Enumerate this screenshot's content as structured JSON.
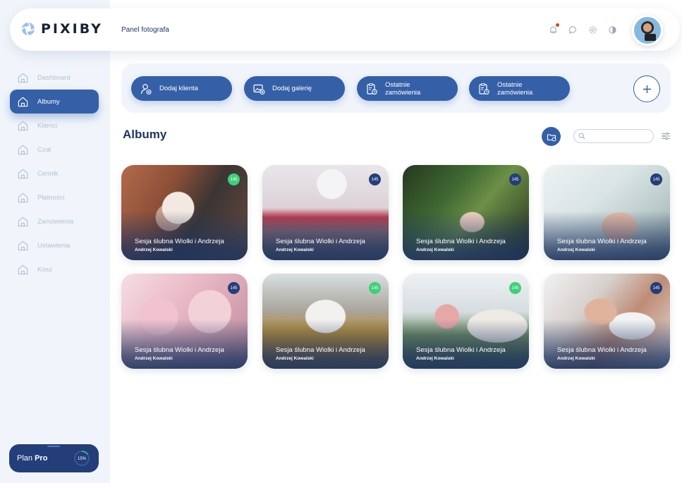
{
  "app": {
    "logo_text": "PIXIBY",
    "subtitle": "Panel fotografa"
  },
  "header_icons": [
    "bell-icon",
    "chat-icon",
    "gear-icon",
    "contrast-icon"
  ],
  "sidebar": {
    "items": [
      {
        "label": "Dashboard",
        "icon": "home-icon",
        "active": false
      },
      {
        "label": "Albumy",
        "icon": "home-icon",
        "active": true
      },
      {
        "label": "Klienci",
        "icon": "home-icon",
        "active": false
      },
      {
        "label": "Czat",
        "icon": "home-icon",
        "active": false
      },
      {
        "label": "Cennik",
        "icon": "home-icon",
        "active": false
      },
      {
        "label": "Płatności",
        "icon": "home-icon",
        "active": false
      },
      {
        "label": "Zamówienia",
        "icon": "home-icon",
        "active": false
      },
      {
        "label": "Ustawienia",
        "icon": "home-icon",
        "active": false
      },
      {
        "label": "Kosz",
        "icon": "home-icon",
        "active": false
      }
    ],
    "plan": {
      "prefix": "Plan",
      "name": "Pro",
      "progress_label": "15%",
      "progress": 0.15
    }
  },
  "actions": [
    {
      "label": "Dodaj klienta",
      "icon": "add-user-icon"
    },
    {
      "label": "Dodaj galerię",
      "icon": "add-gallery-icon"
    },
    {
      "label": "Ostatnie zamówienia",
      "icon": "clipboard-clock-icon"
    },
    {
      "label": "Ostatnie zamówienia",
      "icon": "clipboard-clock-icon"
    }
  ],
  "main": {
    "title": "Albumy",
    "search_placeholder": ""
  },
  "colors": {
    "primary": "#3560a8",
    "dark": "#233e79",
    "badge_green": "#3fd07a",
    "badge_blue": "#233e79"
  },
  "albums": [
    {
      "title": "Sesja ślubna Wiolki i Andrzeja",
      "author": "Andrzej Kowalski",
      "count": "145",
      "badge": "green"
    },
    {
      "title": "Sesja ślubna Wiolki i Andrzeja",
      "author": "Andrzej Kowalski",
      "count": "145",
      "badge": "blue"
    },
    {
      "title": "Sesja ślubna Wiolki i Andrzeja",
      "author": "Andrzej Kowalski",
      "count": "145",
      "badge": "blue"
    },
    {
      "title": "Sesja ślubna Wiolki i Andrzeja",
      "author": "Andrzej Kowalski",
      "count": "145",
      "badge": "blue"
    },
    {
      "title": "Sesja ślubna Wiolki i Andrzeja",
      "author": "Andrzej Kowalski",
      "count": "145",
      "badge": "blue"
    },
    {
      "title": "Sesja ślubna Wiolki i Andrzeja",
      "author": "Andrzej Kowalski",
      "count": "145",
      "badge": "green"
    },
    {
      "title": "Sesja ślubna Wiolki i Andrzeja",
      "author": "Andrzej Kowalski",
      "count": "145",
      "badge": "green"
    },
    {
      "title": "Sesja ślubna Wiolki i Andrzeja",
      "author": "Andrzej Kowalski",
      "count": "145",
      "badge": "blue"
    }
  ]
}
